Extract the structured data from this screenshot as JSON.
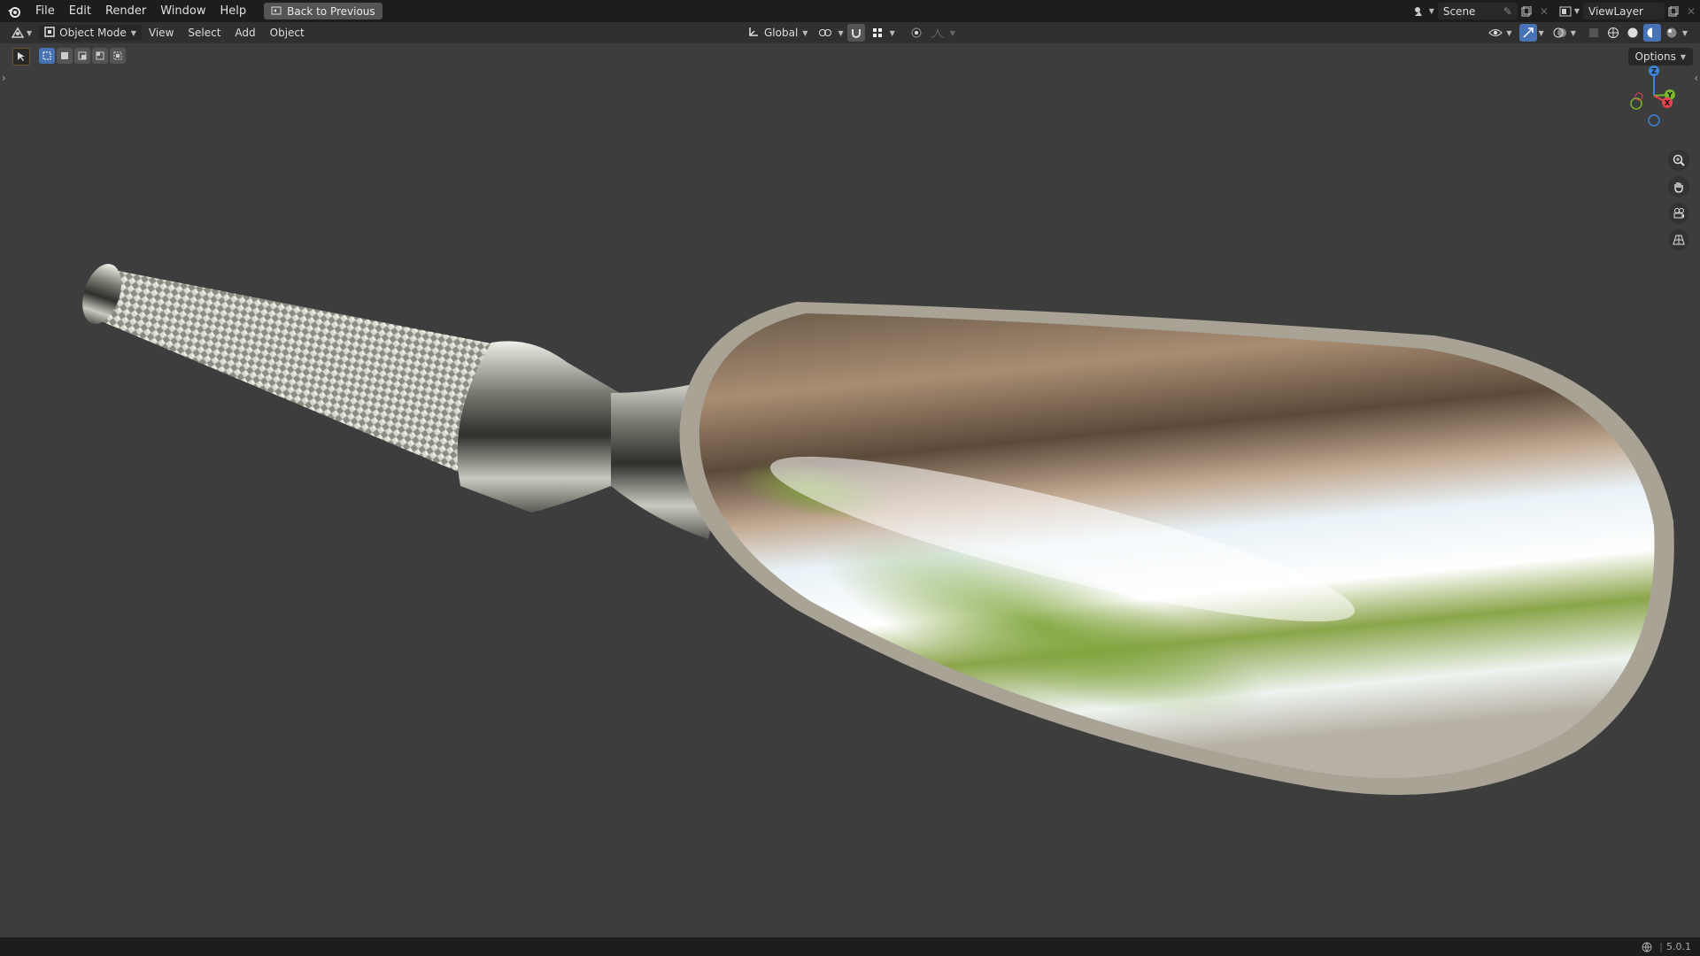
{
  "topbar": {
    "menus": [
      "File",
      "Edit",
      "Render",
      "Window",
      "Help"
    ],
    "back_label": "Back to Previous",
    "scene_name": "Scene",
    "viewlayer_name": "ViewLayer"
  },
  "header": {
    "mode": "Object Mode",
    "menus": [
      "View",
      "Select",
      "Add",
      "Object"
    ],
    "orientation": "Global"
  },
  "viewport": {
    "options_label": "Options",
    "gizmo": {
      "z": "Z",
      "y": "Y",
      "x": "X"
    }
  },
  "status": {
    "version": "5.0.1"
  },
  "colors": {
    "accent": "#4772b3",
    "axis_x": "#e8424f",
    "axis_y": "#7ab62e",
    "axis_z": "#3a85d8"
  }
}
